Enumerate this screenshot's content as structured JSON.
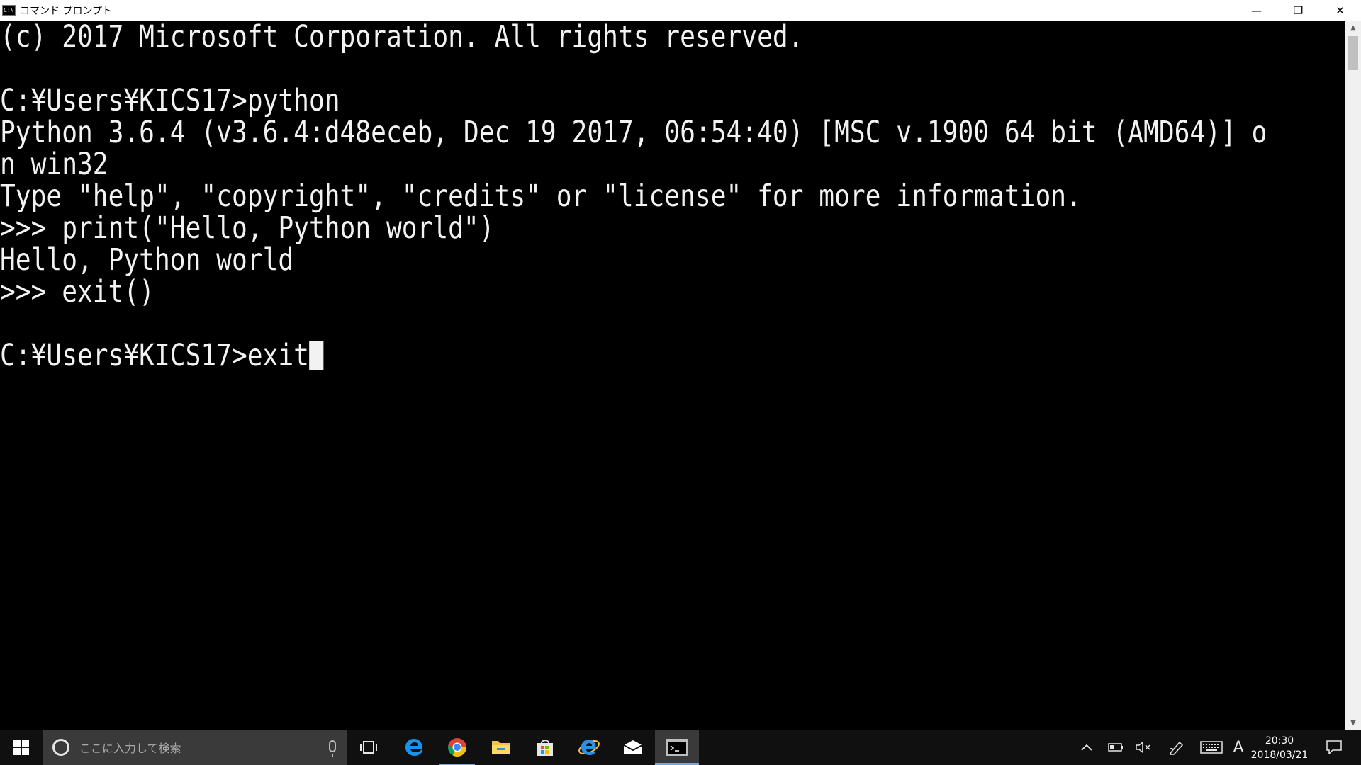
{
  "window": {
    "icon_text": "C:\\",
    "title": "コマンド プロンプト",
    "minimize_glyph": "—",
    "maximize_glyph": "❐",
    "close_glyph": "✕"
  },
  "console": {
    "lines": [
      "(c) 2017 Microsoft Corporation. All rights reserved.",
      "",
      "C:¥Users¥KICS17>python",
      "Python 3.6.4 (v3.6.4:d48eceb, Dec 19 2017, 06:54:40) [MSC v.1900 64 bit (AMD64)] o",
      "n win32",
      "Type \"help\", \"copyright\", \"credits\" or \"license\" for more information.",
      ">>> print(\"Hello, Python world\")",
      "Hello, Python world",
      ">>> exit()",
      "",
      "C:¥Users¥KICS17>exit"
    ],
    "colors": {
      "background": "#000000",
      "text": "#f2f2f2"
    }
  },
  "scrollbar": {
    "up_glyph": "▲",
    "down_glyph": "▼"
  },
  "taskbar": {
    "search_placeholder": "ここに入力して検索",
    "pinned_apps": [
      "edge",
      "chrome",
      "file-explorer",
      "store",
      "internet-explorer",
      "mail",
      "command-prompt"
    ],
    "tray": {
      "chevron": "^",
      "ime_mode": "A",
      "time": "20:30",
      "date": "2018/03/21"
    },
    "colors": {
      "background": "#101010",
      "accent": "#7aa7d8"
    }
  }
}
